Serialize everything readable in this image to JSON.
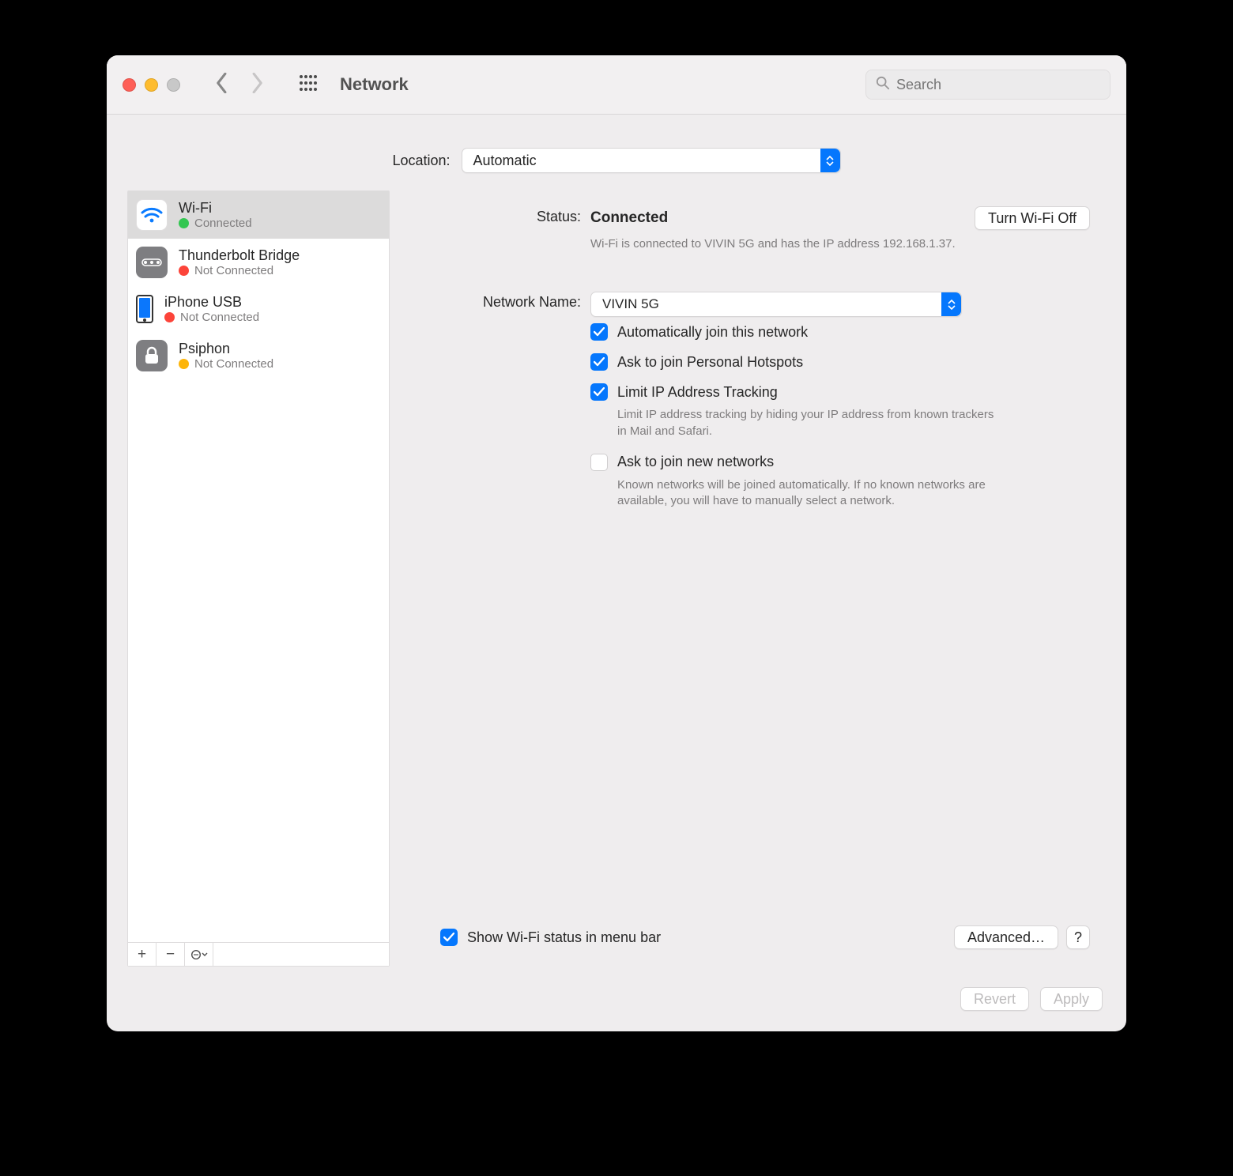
{
  "title": "Network",
  "search_placeholder": "Search",
  "location": {
    "label": "Location:",
    "value": "Automatic"
  },
  "sidebar": {
    "items": [
      {
        "name": "Wi-Fi",
        "status": "Connected",
        "color": "green",
        "selected": true,
        "icon": "wifi"
      },
      {
        "name": "Thunderbolt Bridge",
        "status": "Not Connected",
        "color": "red",
        "selected": false,
        "icon": "thunderbolt"
      },
      {
        "name": "iPhone USB",
        "status": "Not Connected",
        "color": "red",
        "selected": false,
        "icon": "phone"
      },
      {
        "name": "Psiphon",
        "status": "Not Connected",
        "color": "amber",
        "selected": false,
        "icon": "lock"
      }
    ]
  },
  "status": {
    "label": "Status:",
    "value": "Connected",
    "wifi_btn": "Turn Wi-Fi Off",
    "detail": "Wi-Fi is connected to VIVIN 5G and has the IP address 192.168.1.37."
  },
  "network_name": {
    "label": "Network Name:",
    "value": "VIVIN 5G"
  },
  "options": {
    "auto_join": {
      "label": "Automatically join this network",
      "checked": true
    },
    "ask_hotspot": {
      "label": "Ask to join Personal Hotspots",
      "checked": true
    },
    "limit_ip": {
      "label": "Limit IP Address Tracking",
      "checked": true,
      "help": "Limit IP address tracking by hiding your IP address from known trackers in Mail and Safari."
    },
    "ask_new": {
      "label": "Ask to join new networks",
      "checked": false,
      "help": "Known networks will be joined automatically. If no known networks are available, you will have to manually select a network."
    },
    "menu_bar": {
      "label": "Show Wi-Fi status in menu bar",
      "checked": true
    }
  },
  "advanced": "Advanced…",
  "help": "?",
  "footer": {
    "revert": "Revert",
    "apply": "Apply"
  }
}
